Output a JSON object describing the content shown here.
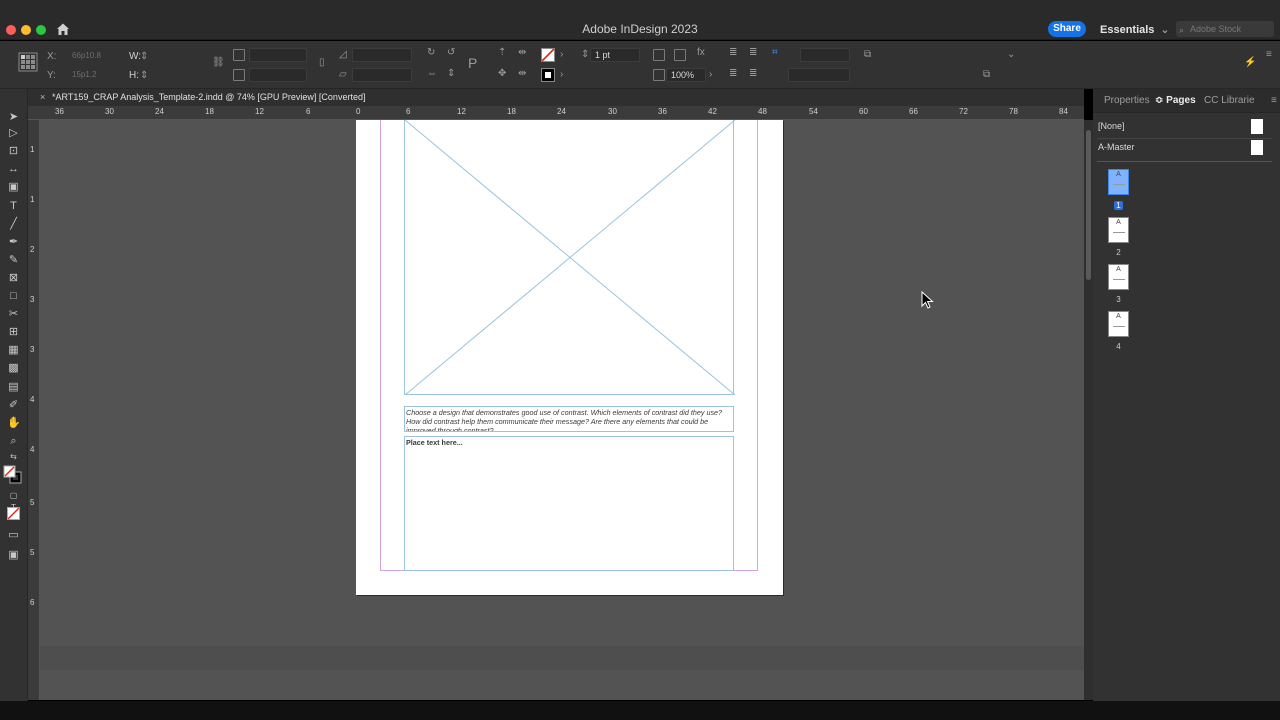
{
  "window": {
    "title": "Adobe InDesign 2023",
    "share_label": "Share",
    "workspace_label": "Essentials",
    "stock_search_placeholder": "Adobe Stock"
  },
  "control_bar": {
    "x_label": "X:",
    "x_value": "66p10.8",
    "y_label": "Y:",
    "y_value": "15p1.2",
    "w_label": "W:",
    "h_label": "H:",
    "stroke_weight": "1 pt",
    "opacity": "100%",
    "object_style": "[Basic Graphics Frame]"
  },
  "document": {
    "tab_label": "*ART159_CRAP Analysis_Template-2.indd @ 74% [GPU Preview] [Converted]",
    "prompt_text": "Choose a design that demonstrates good use of contrast. Which elements of contrast did they use? How did contrast help them communicate their message? Are there any elements that could be improved through contrast?",
    "placeholder_text": "Place text here..."
  },
  "rulers": {
    "top_labels": [
      "36",
      "30",
      "24",
      "18",
      "12",
      "6",
      "0",
      "6",
      "12",
      "18",
      "24",
      "30",
      "36",
      "42",
      "48",
      "54",
      "60",
      "66",
      "72",
      "78",
      "84"
    ],
    "left_labels": [
      "1",
      "1",
      "2",
      "3",
      "3",
      "4",
      "4",
      "5",
      "5",
      "6"
    ]
  },
  "right_panel": {
    "tabs": [
      "Properties",
      "Pages",
      "CC Librarie"
    ],
    "active_tab": "Pages",
    "masters": [
      "[None]",
      "A-Master"
    ],
    "pages": [
      {
        "number": "1",
        "master": "A",
        "selected": true
      },
      {
        "number": "2",
        "master": "A",
        "selected": false
      },
      {
        "number": "3",
        "master": "A",
        "selected": false
      },
      {
        "number": "4",
        "master": "A",
        "selected": false
      }
    ]
  },
  "colors": {
    "accent": "#1473e6",
    "frame_edge": "#9cc4db",
    "margin_guide": "#d9a3da",
    "pasteboard": "#535353"
  }
}
